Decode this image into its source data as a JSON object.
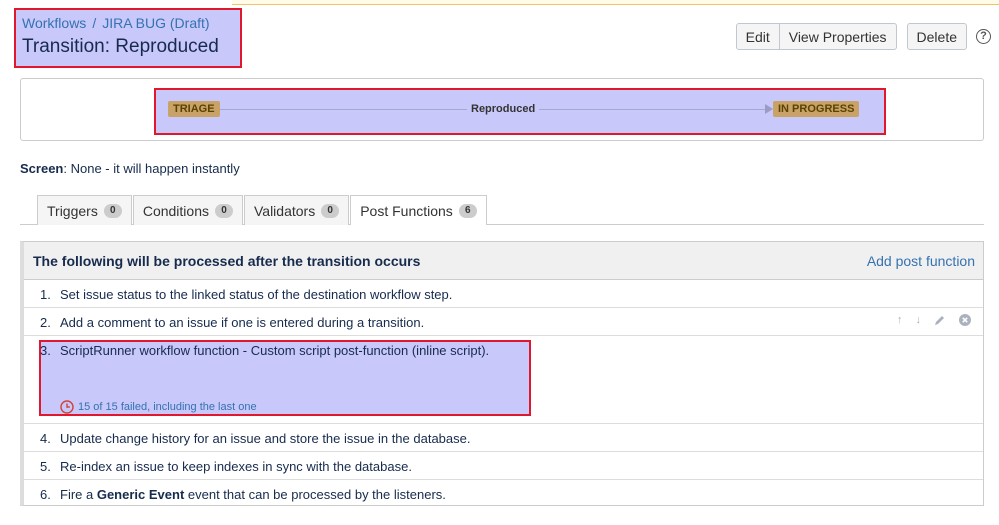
{
  "breadcrumb": {
    "workflows": "Workflows",
    "separator": "/",
    "workflow": "JIRA BUG (Draft)"
  },
  "page_title": "Transition: Reproduced",
  "toolbar": {
    "edit": "Edit",
    "view_properties": "View Properties",
    "delete": "Delete",
    "help": "?"
  },
  "diagram": {
    "from_status": "TRIAGE",
    "transition": "Reproduced",
    "to_status": "IN PROGRESS"
  },
  "screen": {
    "label": "Screen",
    "value": ": None - it will happen instantly"
  },
  "tabs": [
    {
      "label": "Triggers",
      "count": "0"
    },
    {
      "label": "Conditions",
      "count": "0"
    },
    {
      "label": "Validators",
      "count": "0"
    },
    {
      "label": "Post Functions",
      "count": "6"
    }
  ],
  "post_functions": {
    "heading": "The following will be processed after the transition occurs",
    "add_link": "Add post function",
    "items": [
      {
        "num": "1.",
        "text": "Set issue status to the linked status of the destination workflow step."
      },
      {
        "num": "2.",
        "text": "Add a comment to an issue if one is entered during a transition."
      },
      {
        "num": "3.",
        "text": "ScriptRunner workflow function - Custom script post-function (inline script).",
        "status": "15 of 15 failed, including the last one"
      },
      {
        "num": "4.",
        "text": "Update change history for an issue and store the issue in the database."
      },
      {
        "num": "5.",
        "text": "Re-index an issue to keep indexes in sync with the database."
      },
      {
        "num": "6.",
        "text_before": "Fire a ",
        "text_bold": "Generic Event",
        "text_after": " event that can be processed by the listeners."
      }
    ]
  },
  "row_action_icons": {
    "up": "↑",
    "down": "↓"
  },
  "colors": {
    "link": "#3572b0",
    "highlight": "#c8c8fb",
    "highlight_border": "#e0182d",
    "lozenge": "#c9a267"
  }
}
